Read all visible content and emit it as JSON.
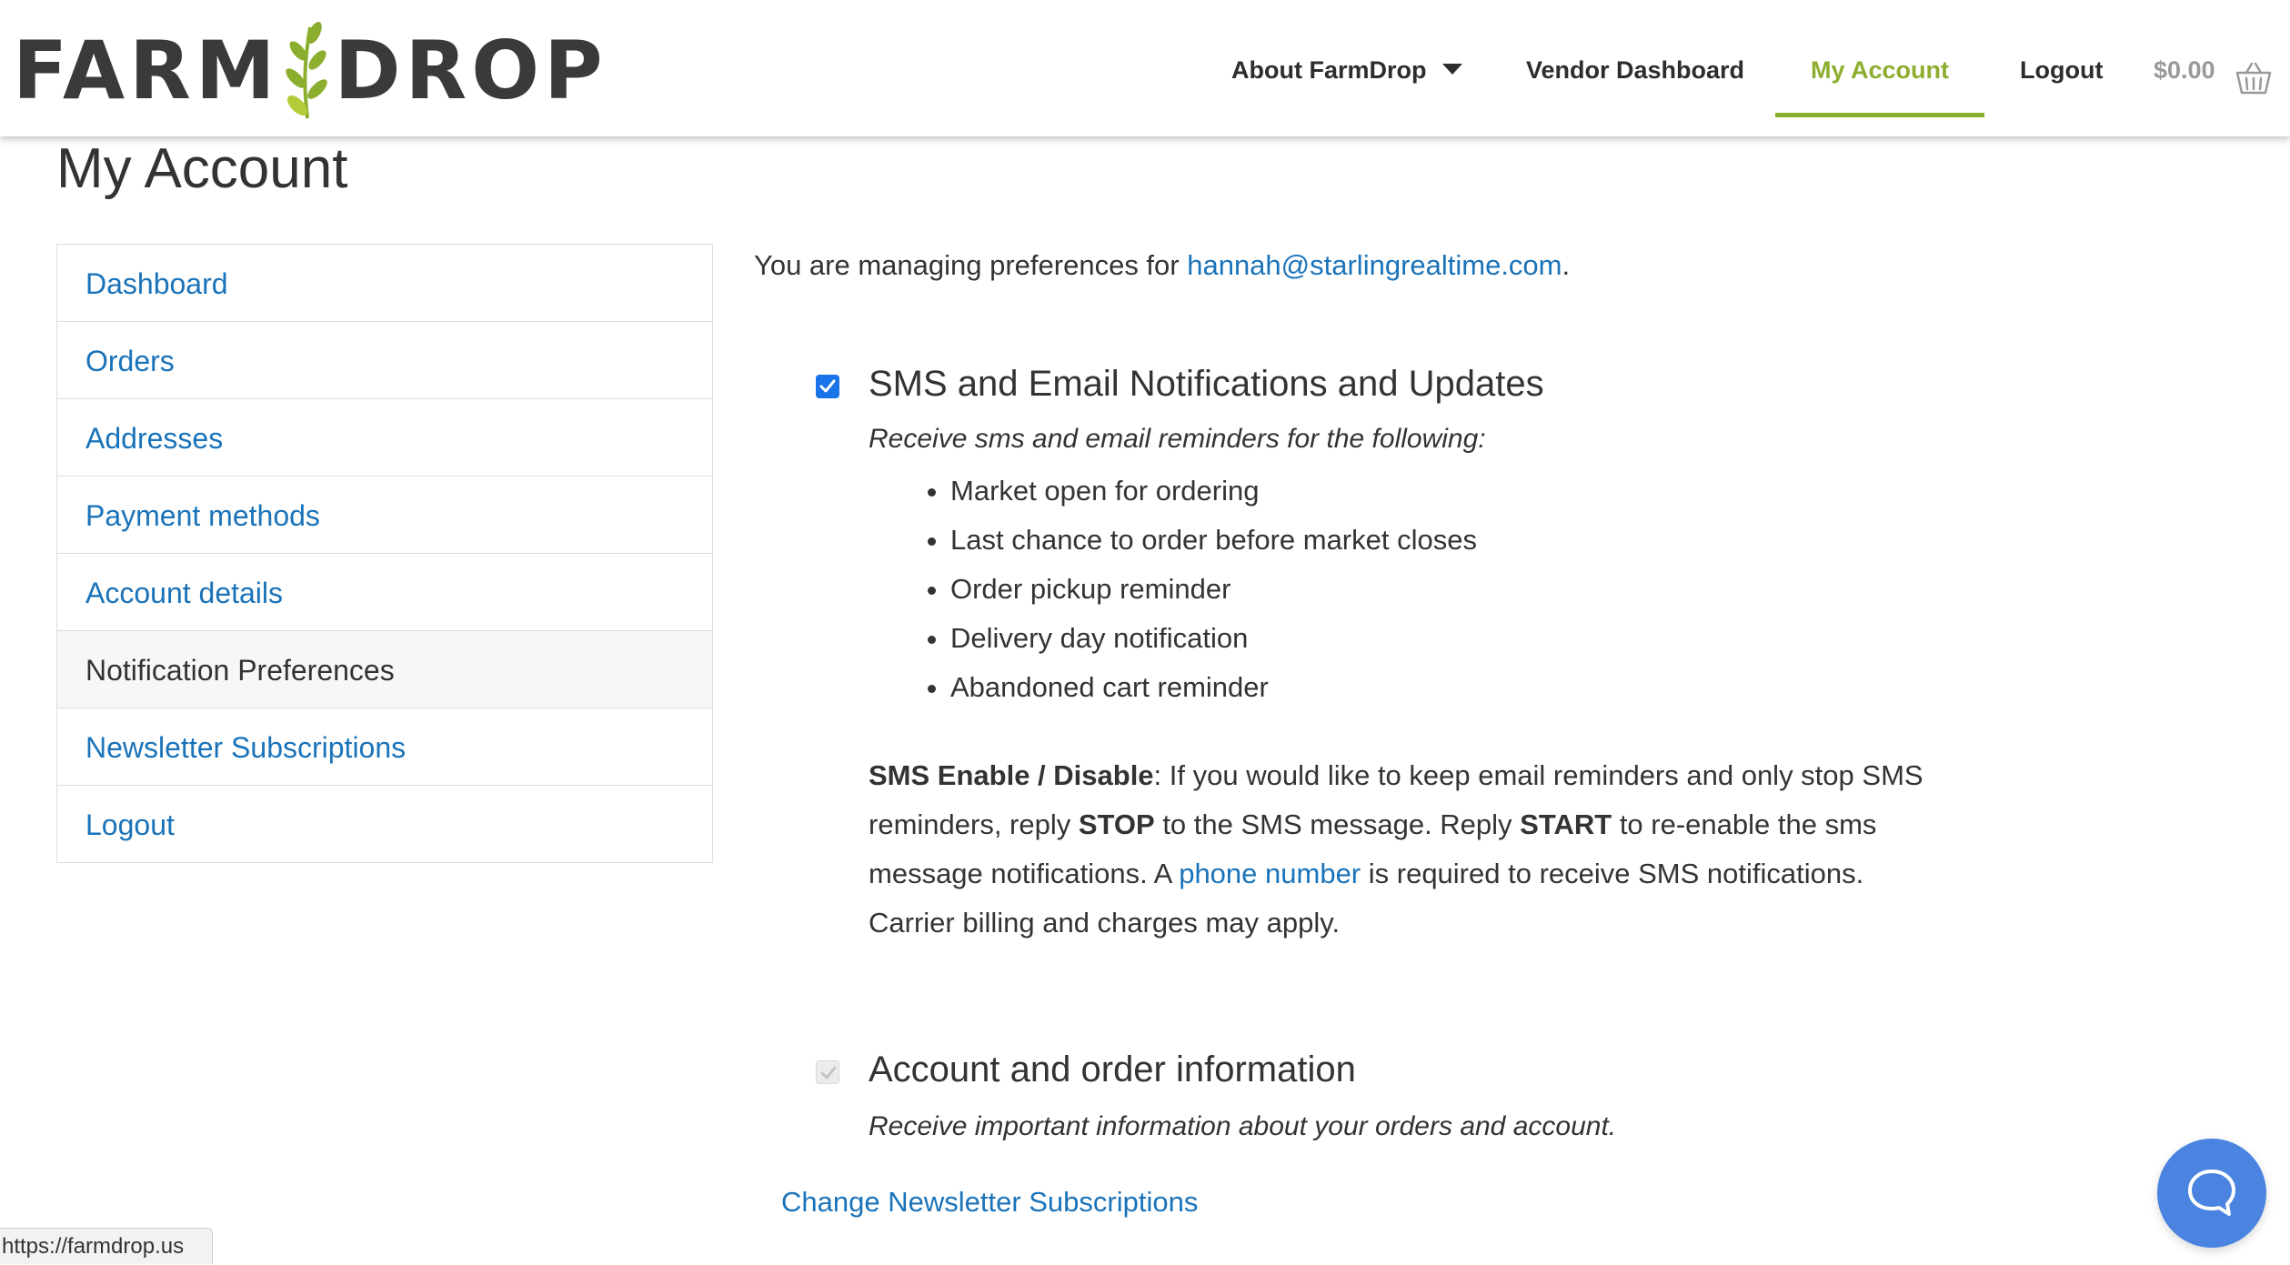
{
  "brand": {
    "logo_left": "FARM",
    "logo_right": "DROP",
    "accent_color": "#8cae2e",
    "link_color": "#1a73b9"
  },
  "nav": {
    "about": "About FarmDrop",
    "vendor": "Vendor Dashboard",
    "account": "My Account",
    "logout": "Logout",
    "cart_total": "$0.00",
    "cart_icon": "basket-icon"
  },
  "page": {
    "title": "My Account"
  },
  "sidebar": {
    "items": [
      {
        "label": "Dashboard"
      },
      {
        "label": "Orders"
      },
      {
        "label": "Addresses"
      },
      {
        "label": "Payment methods"
      },
      {
        "label": "Account details"
      },
      {
        "label": "Notification Preferences"
      },
      {
        "label": "Newsletter Subscriptions"
      },
      {
        "label": "Logout"
      }
    ],
    "active_index": 5
  },
  "content": {
    "intro_prefix": "You are managing preferences for ",
    "email": "hannah@starlingrealtime.com",
    "intro_suffix": ".",
    "sms_pref": {
      "checked": true,
      "title": "SMS and Email Notifications and Updates",
      "desc": "Receive sms and email reminders for the following:",
      "items": [
        "Market open for ordering",
        "Last chance to order before market closes",
        "Order pickup reminder",
        "Delivery day notification",
        "Abandoned cart reminder"
      ],
      "para_label": "SMS Enable / Disable",
      "para_1": ": If you would like to keep email reminders and only stop SMS reminders, reply ",
      "stop_word": "STOP",
      "para_2": " to the SMS message. Reply ",
      "start_word": "START",
      "para_3": " to re-enable the sms message notifications. A ",
      "phone_link": "phone number",
      "para_4": " is required to receive SMS notifications. Carrier billing and charges may apply."
    },
    "account_pref": {
      "checked": true,
      "disabled": true,
      "title": "Account and order information",
      "desc": "Receive important information about your orders and account."
    },
    "change_link": "Change Newsletter Subscriptions"
  },
  "status_url": "https://farmdrop.us",
  "chat_icon": "chat-bubble-icon"
}
